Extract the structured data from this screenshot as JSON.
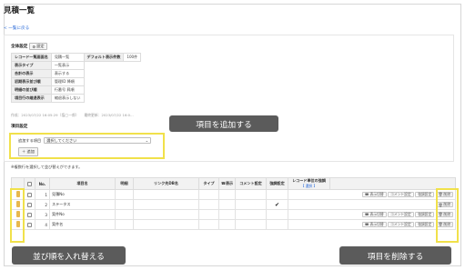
{
  "page": {
    "title": "見積一覧",
    "back_link": "< 一覧に戻る"
  },
  "general": {
    "section_title": "全体設定",
    "settings_button": "設定",
    "rows": [
      {
        "k1": "レコード一覧画面名",
        "v1": "見積一覧",
        "k2": "デフォルト表示件数",
        "v2": "100件"
      },
      {
        "k1": "表示タイプ",
        "v1": "一覧表示"
      },
      {
        "k1": "合計の表示",
        "v1": "表示する"
      },
      {
        "k1": "初期表示並び順",
        "v1": "管理ID 降順"
      },
      {
        "k1": "明細の並び順",
        "v1": "行番号 昇順"
      },
      {
        "k1": "項目行の縮退表示",
        "v1": "縮退表示しない"
      }
    ],
    "meta": "作成：2023/07/22 16:05:29（塩◯一郎）　　最終更新：2023/07/22 16:0..."
  },
  "field_settings": {
    "section_title": "項目設定",
    "add_label": "追加する項目",
    "select_placeholder": "選択してください",
    "add_button": "追加"
  },
  "hint": "※複数行を選択して並び替えができます。",
  "table": {
    "headers": {
      "no": "No.",
      "name": "項目名",
      "detail": "明細",
      "link": "リンク先DB名",
      "type": "タイプ",
      "display": "表示",
      "comment": "コメント設定",
      "emphasis": "強調設定",
      "record_unit": "レコード単位の強調",
      "record_unit_sub": "【 選択 】"
    },
    "rows": [
      {
        "no": "1",
        "name": "見積No",
        "checked": false
      },
      {
        "no": "2",
        "name": "ステータス",
        "checked": true
      },
      {
        "no": "3",
        "name": "案件No",
        "checked": false
      },
      {
        "no": "4",
        "name": "案件名",
        "checked": false
      }
    ],
    "btn_display_switch": "表示切替",
    "btn_comment": "コメント設定",
    "btn_emphasis": "強調設定",
    "btn_delete": "削除"
  },
  "callouts": {
    "add_item": "項目を追加する",
    "reorder": "並び順を入れ替える",
    "delete_item": "項目を削除する"
  },
  "colors": {
    "highlight": "#f1e14a",
    "callout_bg": "#5b5b5b",
    "link": "#2a6ad8"
  }
}
